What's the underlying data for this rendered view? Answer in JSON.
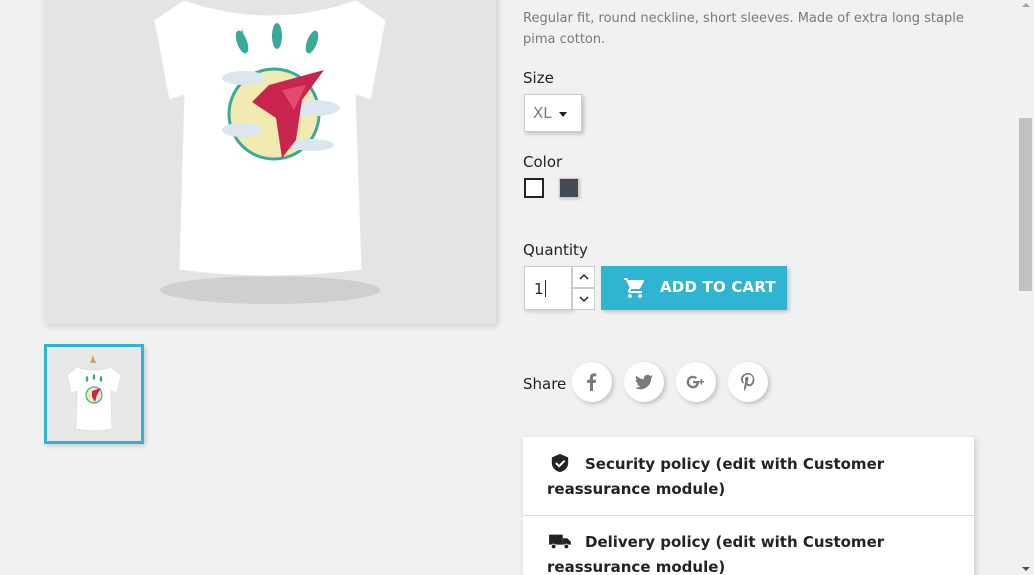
{
  "product": {
    "description": "Regular fit, round neckline, short sleeves. Made of extra long staple pima cotton.",
    "image_name": "hummingbird-tshirt-image",
    "thumbnail_name": "hummingbird-tshirt-thumbnail"
  },
  "size": {
    "label": "Size",
    "selected": "XL"
  },
  "color": {
    "label": "Color",
    "options": [
      {
        "name": "White",
        "hex": "#ffffff",
        "selected": true
      },
      {
        "name": "Black",
        "hex": "#434a54",
        "selected": false
      }
    ]
  },
  "quantity": {
    "label": "Quantity",
    "value": "1"
  },
  "cart": {
    "add_label": "ADD TO CART",
    "accent": "#2fb5d2"
  },
  "share": {
    "label": "Share",
    "networks": [
      "facebook-icon",
      "twitter-icon",
      "google-plus-icon",
      "pinterest-icon"
    ]
  },
  "reassurance": {
    "items": [
      {
        "icon": "shield-check-icon",
        "text": "Security policy (edit with Customer reassurance module)"
      },
      {
        "icon": "truck-icon",
        "text": "Delivery policy (edit with Customer reassurance module)"
      }
    ]
  }
}
